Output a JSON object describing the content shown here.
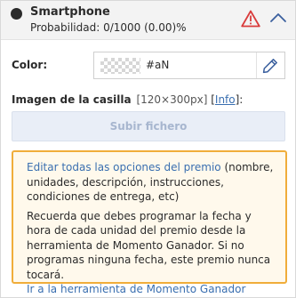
{
  "header": {
    "title": "Smartphone",
    "probability": "Probabilidad: 0/1000 (0.00)%"
  },
  "color": {
    "label": "Color:",
    "value": "#aN"
  },
  "image": {
    "label": "Imagen de la casilla",
    "size": "[120×300px]",
    "info_bracket_open": "[",
    "info_link": "Info",
    "info_bracket_close": "]:",
    "upload_button": "Subir fichero"
  },
  "notice": {
    "edit_link": "Editar todas las opciones del premio",
    "edit_text": " (nombre, unidades, descripción, instrucciones, condiciones de entrega, etc)",
    "reminder": "Recuerda que debes programar la fecha y hora de cada unidad del premio desde la herramienta de Momento Ganador. Si no programas ninguna fecha, este premio nunca tocará.",
    "tool_link": "Ir a la herramienta de Momento Ganador"
  },
  "colors": {
    "accent_link": "#3a6fb0",
    "warning_red": "#d93b3b",
    "notice_border": "#f0ad3a",
    "notice_background": "#fff9ec",
    "upload_background": "#e9eef7"
  },
  "icons": {
    "status": "status-dot-icon",
    "warning": "warning-triangle-icon",
    "collapse": "chevron-up-icon",
    "edit_color": "pencil-icon"
  }
}
